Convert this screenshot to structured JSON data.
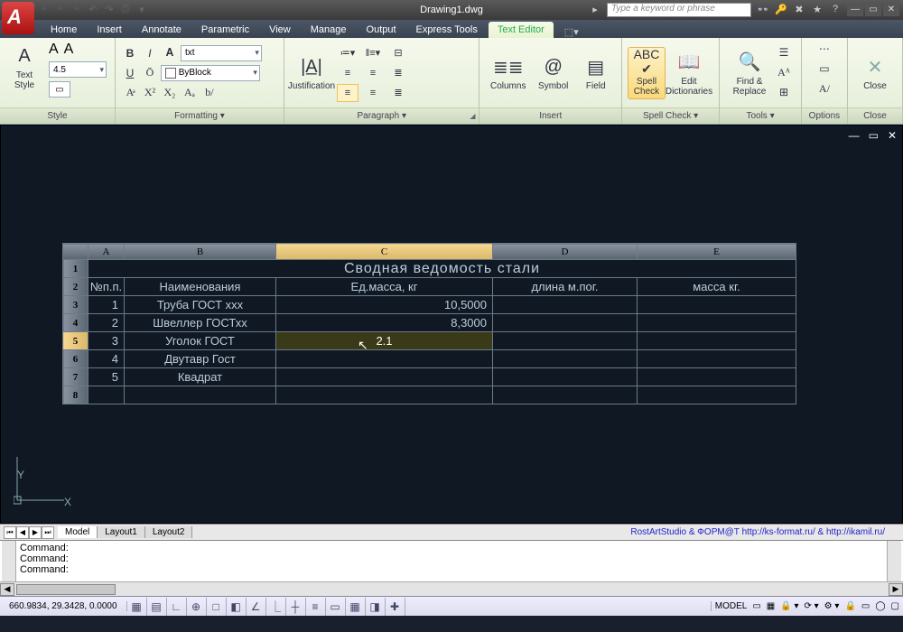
{
  "titlebar": {
    "filename": "Drawing1.dwg",
    "search_placeholder": "Type a keyword or phrase"
  },
  "tabs": {
    "items": [
      "Home",
      "Insert",
      "Annotate",
      "Parametric",
      "View",
      "Manage",
      "Output",
      "Express Tools",
      "Text Editor"
    ],
    "active": "Text Editor"
  },
  "ribbon": {
    "style": {
      "label": "Style",
      "font_size": "4.5",
      "text_style_label": "Text\nStyle"
    },
    "formatting": {
      "label": "Formatting ▾",
      "font_name": "txt",
      "layer": "ByBlock"
    },
    "paragraph": {
      "label": "Paragraph ▾",
      "justification": "Justification"
    },
    "insert": {
      "label": "Insert",
      "columns": "Columns",
      "symbol": "Symbol",
      "field": "Field"
    },
    "spellcheck": {
      "label": "Spell Check ▾",
      "spell": "Spell\nCheck",
      "dict": "Edit\nDictionaries"
    },
    "tools": {
      "label": "Tools ▾",
      "find": "Find &\nReplace"
    },
    "options": {
      "label": "Options"
    },
    "close": {
      "label": "Close",
      "btn": "Close"
    }
  },
  "table": {
    "cols": [
      "",
      "A",
      "B",
      "C",
      "D",
      "E"
    ],
    "title": "Сводная ведомость стали",
    "headers": {
      "num": "№п.п.",
      "name": "Наименования",
      "mass": "Ед.масса, кг",
      "len": "длина м.пог.",
      "weight": "масса кг."
    },
    "rows": [
      {
        "n": "1",
        "name": "Труба ГОСТ ххх",
        "mass": "10,5000"
      },
      {
        "n": "2",
        "name": "Швеллер ГОСТхх",
        "mass": "8,3000"
      },
      {
        "n": "3",
        "name": "Уголок ГОСТ",
        "mass": "2.1"
      },
      {
        "n": "4",
        "name": "Двутавр Гост",
        "mass": ""
      },
      {
        "n": "5",
        "name": "Квадрат",
        "mass": ""
      }
    ],
    "editing_row": 2
  },
  "layout_tabs": [
    "Model",
    "Layout1",
    "Layout2"
  ],
  "credit": "RostArtStudio & ФОРМ@Т http://ks-format.ru/ & http://ikamil.ru/",
  "command": {
    "lines": [
      "Command:",
      "Command:",
      "Command:"
    ]
  },
  "status": {
    "coords": "660.9834, 29.3428, 0.0000",
    "model": "MODEL"
  },
  "ucs": {
    "x": "X",
    "y": "Y"
  }
}
